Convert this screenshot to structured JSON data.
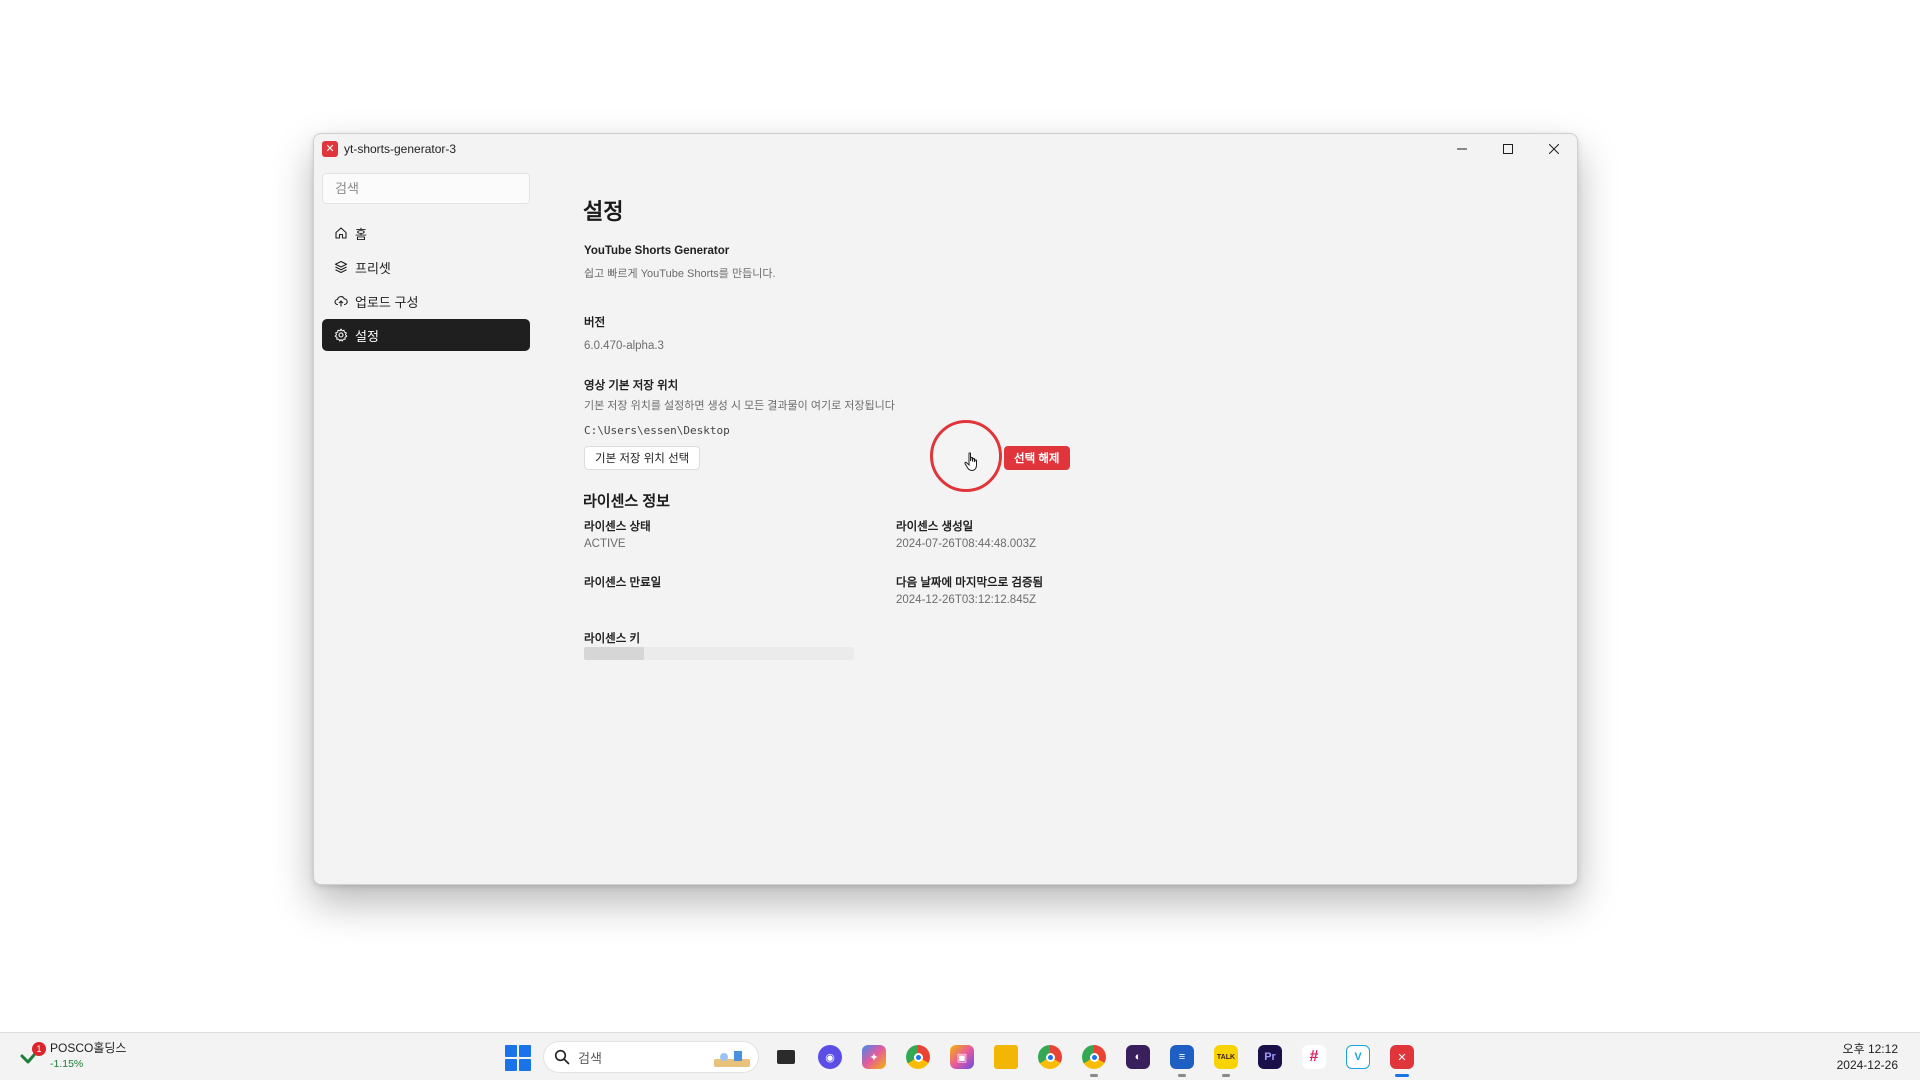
{
  "window": {
    "title": "yt-shorts-generator-3"
  },
  "sidebar": {
    "search_placeholder": "검색",
    "items": [
      {
        "label": "홈",
        "icon": "home-icon"
      },
      {
        "label": "프리셋",
        "icon": "preset-icon"
      },
      {
        "label": "업로드 구성",
        "icon": "upload-icon"
      },
      {
        "label": "설정",
        "icon": "gear-icon",
        "active": true
      }
    ]
  },
  "main": {
    "title": "설정",
    "app": {
      "name": "YouTube Shorts Generator",
      "description": "쉽고 빠르게 YouTube Shorts를 만듭니다."
    },
    "version": {
      "label": "버전",
      "value": "6.0.470-alpha.3"
    },
    "storage": {
      "label": "영상 기본 저장 위치",
      "description": "기본 저장 위치를 설정하면 생성 시 모든 결과물이 여기로 저장됩니다",
      "path": "C:\\Users\\essen\\Desktop",
      "select_button": "기본 저장 위치 선택",
      "clear_button": "선택 해제"
    },
    "license": {
      "section_title": "라이센스 정보",
      "status_label": "라이센스 상태",
      "status_value": "ACTIVE",
      "created_label": "라이센스 생성일",
      "created_value": "2024-07-26T08:44:48.003Z",
      "expiry_label": "라이센스 만료일",
      "expiry_value": "",
      "verified_label": "다음 날짜에 마지막으로 검증됨",
      "verified_value": "2024-12-26T03:12:12.845Z",
      "key_label": "라이센스 키"
    }
  },
  "taskbar": {
    "stock": {
      "badge": "1",
      "name": "POSCO홀딩스",
      "change": "-1.15%"
    },
    "search_placeholder": "검색",
    "apps": [
      {
        "name": "task-view-icon",
        "color": "#2b2b2b"
      },
      {
        "name": "messenger-icon",
        "color": "#5b4ee6"
      },
      {
        "name": "copilot-icon",
        "color": "#3e8bf0"
      },
      {
        "name": "chrome-icon",
        "color": "#1a73e8"
      },
      {
        "name": "photos-icon",
        "color": "#e85a9b"
      },
      {
        "name": "file-explorer-icon",
        "color": "#f2b705"
      },
      {
        "name": "chrome-alt-icon",
        "color": "#34a853"
      },
      {
        "name": "chrome-profile-icon",
        "color": "#ea4335"
      },
      {
        "name": "obsidian-icon",
        "color": "#3a1f5d"
      },
      {
        "name": "app-blue-icon",
        "color": "#1f5fc4"
      },
      {
        "name": "kakaotalk-icon",
        "color": "#f7d300"
      },
      {
        "name": "premiere-icon",
        "color": "#1b0f4a"
      },
      {
        "name": "slack-icon",
        "color": "#e0e0e0"
      },
      {
        "name": "vscode-icon",
        "color": "#18a4e0"
      },
      {
        "name": "yt-shorts-generator-icon",
        "color": "#e0353b"
      }
    ],
    "clock": {
      "time": "오후 12:12",
      "date": "2024-12-26"
    }
  }
}
